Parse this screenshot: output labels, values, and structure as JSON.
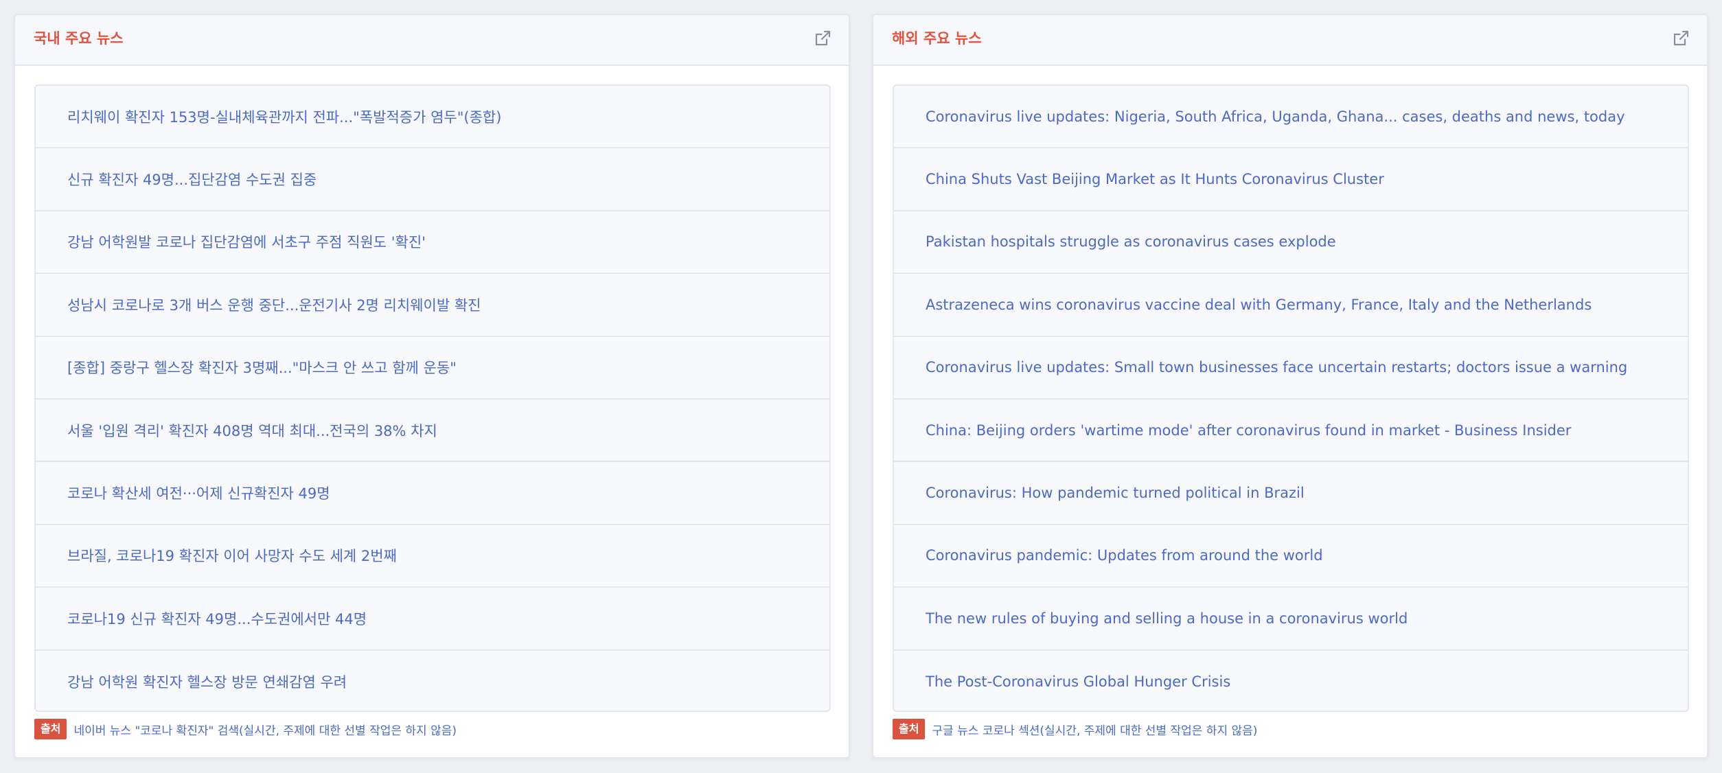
{
  "domestic": {
    "title": "국내 주요 뉴스",
    "items": [
      "리치웨이 확진자 153명-실내체육관까지 전파...\"폭발적증가 염두\"(종합)",
      "신규 확진자 49명...집단감염 수도권 집중",
      "강남 어학원발 코로나 집단감염에 서초구 주점 직원도 '확진'",
      "성남시 코로나로 3개 버스 운행 중단...운전기사 2명 리치웨이발 확진",
      "[종합] 중랑구 헬스장 확진자 3명째...\"마스크 안 쓰고 함께 운동\"",
      "서울 '입원 격리' 확진자 408명 역대 최대...전국의 38% 차지",
      "코로나 확산세 여전···어제 신규확진자 49명",
      "브라질, 코로나19 확진자 이어 사망자 수도 세계 2번째",
      "코로나19 신규 확진자 49명...수도권에서만 44명",
      "강남 어학원 확진자 헬스장 방문 연쇄감염 우려"
    ],
    "source_label": "출처",
    "source_text": "네이버 뉴스 \"코로나 확진자\" 검색(실시간, 주제에 대한 선별 작업은 하지 않음)"
  },
  "overseas": {
    "title": "해외 주요 뉴스",
    "items": [
      "Coronavirus live updates: Nigeria, South Africa, Uganda, Ghana... cases, deaths and news, today",
      "China Shuts Vast Beijing Market as It Hunts Coronavirus Cluster",
      "Pakistan hospitals struggle as coronavirus cases explode",
      "Astrazeneca wins coronavirus vaccine deal with Germany, France, Italy and the Netherlands",
      "Coronavirus live updates: Small town businesses face uncertain restarts; doctors issue a warning",
      "China: Beijing orders 'wartime mode' after coronavirus found in market - Business Insider",
      "Coronavirus: How pandemic turned political in Brazil",
      "Coronavirus pandemic: Updates from around the world",
      "The new rules of buying and selling a house in a coronavirus world",
      "The Post-Coronavirus Global Hunger Crisis"
    ],
    "source_label": "출처",
    "source_text": "구글 뉴스 코로나 섹션(실시간, 주제에 대한 선별 작업은 하지 않음)"
  },
  "icons": {
    "external_link": "external-link-icon"
  },
  "colors": {
    "title": "#e0533f",
    "link": "#4a69c9",
    "badge": "#d9533f"
  }
}
